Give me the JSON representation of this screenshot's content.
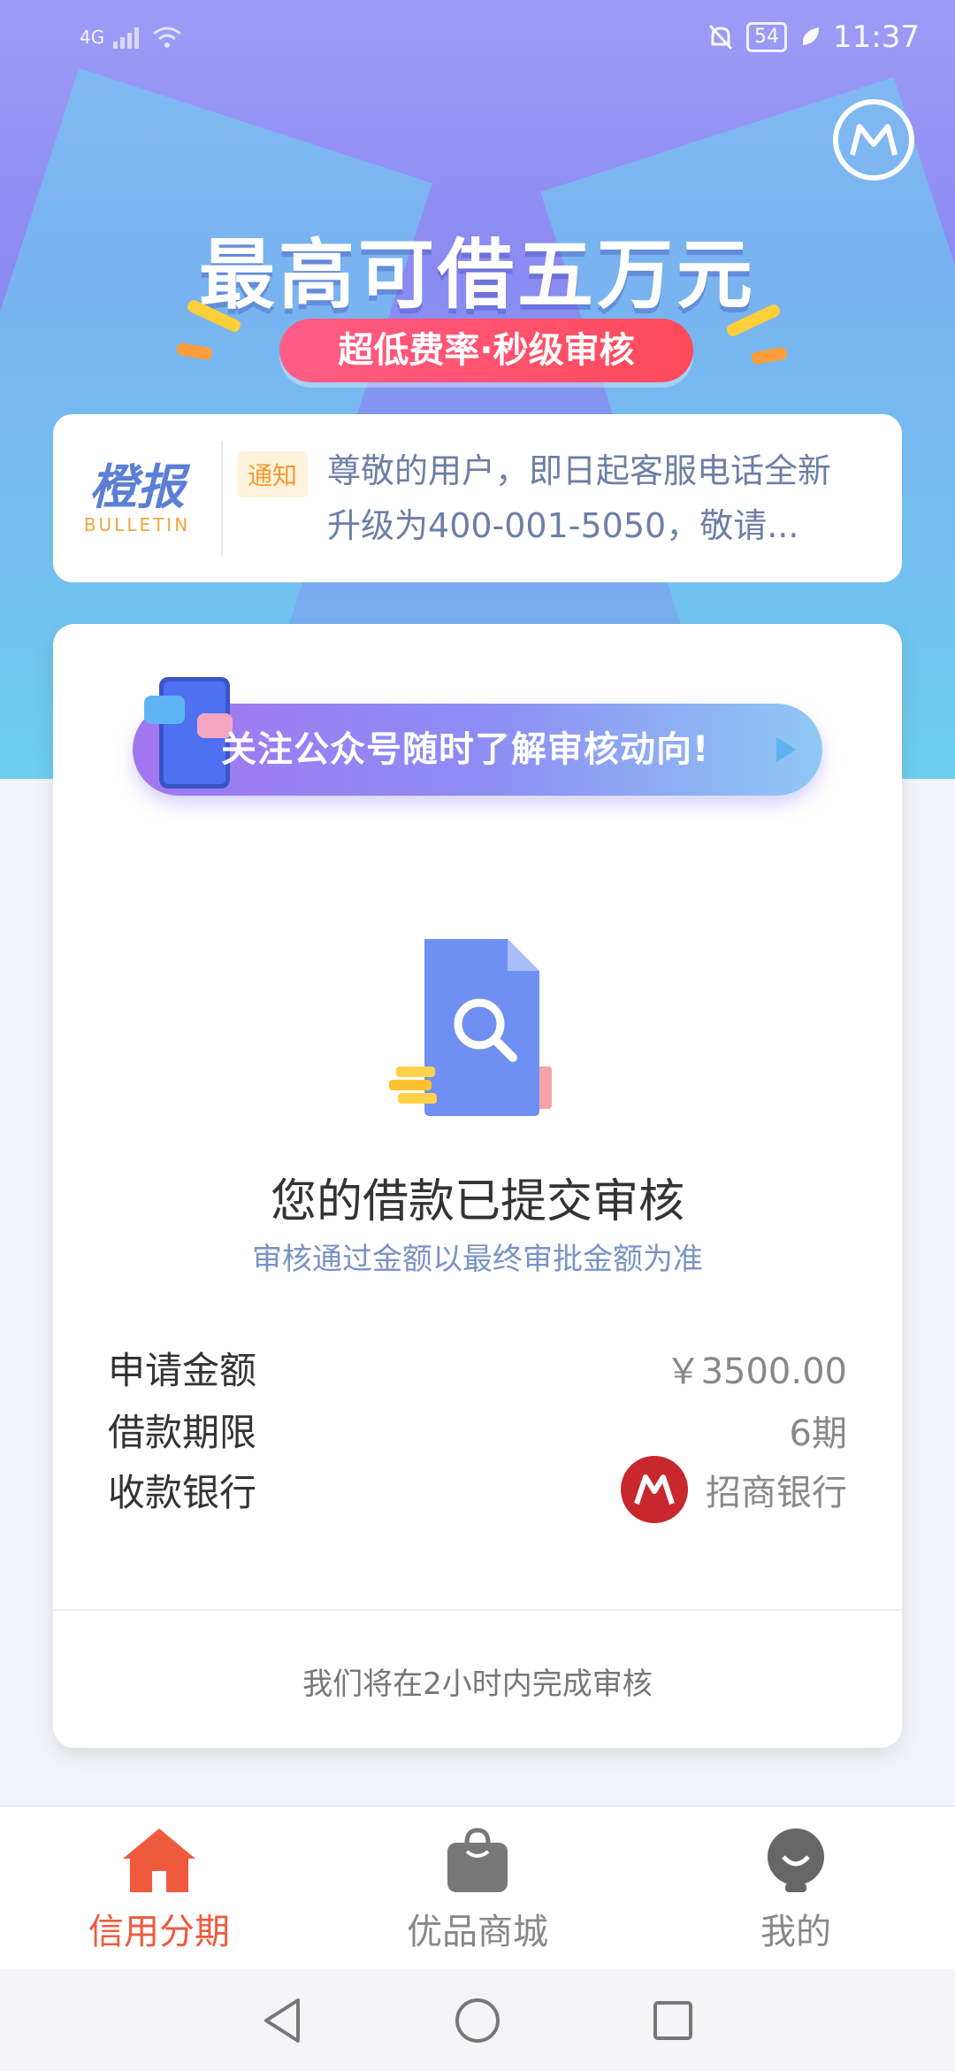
{
  "status_bar": {
    "network": "4G",
    "battery": "54",
    "time": "11:37"
  },
  "hero": {
    "title": "最高可借五万元",
    "subtitle": "超低费率·秒级审核"
  },
  "bulletin": {
    "logo_cn": "橙报",
    "logo_en": "BULLETIN",
    "tag": "通知",
    "text": "尊敬的用户，即日起客服电话全新升级为400-001-5050，敬请..."
  },
  "card": {
    "banner_text": "关注公众号随时了解审核动向!",
    "status_title": "您的借款已提交审核",
    "status_sub": "审核通过金额以最终审批金额为准",
    "rows": [
      {
        "label": "申请金额",
        "value": "￥3500.00"
      },
      {
        "label": "借款期限",
        "value": "6期"
      },
      {
        "label": "收款银行",
        "value": "招商银行"
      }
    ],
    "footer": "我们将在2小时内完成审核"
  },
  "tabs": [
    {
      "label": "信用分期",
      "icon": "home-icon",
      "active": true
    },
    {
      "label": "优品商城",
      "icon": "shopping-bag-icon",
      "active": false
    },
    {
      "label": "我的",
      "icon": "profile-icon",
      "active": false
    }
  ],
  "colors": {
    "accent": "#f05a3c",
    "inactive": "#888888",
    "hero_top": "#9e9cf6",
    "hero_bottom": "#70c8ee"
  }
}
